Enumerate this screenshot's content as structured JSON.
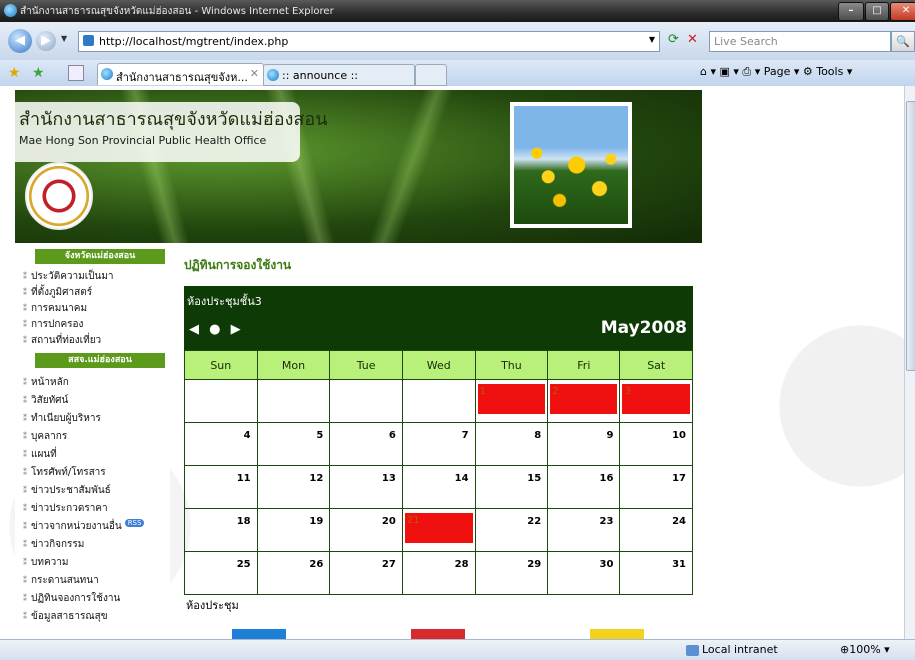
{
  "window": {
    "title": "สำนักงานสาธารณสุขจังหวัดแม่ฮ่องสอน - Windows Internet Explorer",
    "min": "–",
    "max": "□",
    "close": "✕"
  },
  "addressbar": {
    "url": "http://localhost/mgtrent/index.php",
    "search_placeholder": "Live Search",
    "back": "◀",
    "forward": "▶",
    "refresh": "⟳",
    "stop": "✕",
    "search_btn": "🔍"
  },
  "tabs": [
    {
      "label": "สำนักงานสาธารณสุขจังห...",
      "active": true,
      "close": "✕"
    },
    {
      "label": ":: announce ::",
      "active": false
    }
  ],
  "commandbar": "⌂ ▾  ▣ ▾  ⎙ ▾  Page ▾  ⚙ Tools ▾",
  "banner": {
    "title_th": "สำนักงานสาธารณสุขจังหวัดแม่ฮ่องสอน",
    "title_en": "Mae Hong Son Provincial Public Health Office"
  },
  "sidebar": {
    "section1": "จังหวัดแม่ฮ่องสอน",
    "items1": [
      "ประวัติความเป็นมา",
      "ที่ตั้งภูมิศาสตร์",
      "การคมนาคม",
      "การปกครอง",
      "สถานที่ท่องเที่ยว"
    ],
    "section2": "สสจ.แม่ฮ่องสอน",
    "items2": [
      "หน้าหลัก",
      "วิสัยทัศน์",
      "ทำเนียบผู้บริหาร",
      "บุคลากร",
      "แผนที่",
      "โทรศัพท์/โทรสาร",
      "ข่าวประชาสัมพันธ์",
      "ข่าวประกวดราคา",
      "ข่าวจากหน่วยงานอื่น",
      "ข่าวกิจกรรม",
      "บทความ",
      "กระดานสนทนา",
      "ปฏิทินจองการใช้งาน",
      "ข้อมูลสาธารณสุข"
    ],
    "rss_label": "RSS"
  },
  "main": {
    "heading": "ปฏิทินการจองใช้งาน",
    "room": "ห้องประชุมชั้น3",
    "nav": "◀ ● ▶",
    "month": "May2008",
    "weekdays": [
      "Sun",
      "Mon",
      "Tue",
      "Wed",
      "Thu",
      "Fri",
      "Sat"
    ],
    "weeks": [
      [
        "",
        "",
        "",
        "",
        "1",
        "2",
        "3"
      ],
      [
        "4",
        "5",
        "6",
        "7",
        "8",
        "9",
        "10"
      ],
      [
        "11",
        "12",
        "13",
        "14",
        "15",
        "16",
        "17"
      ],
      [
        "18",
        "19",
        "20",
        "21",
        "22",
        "23",
        "24"
      ],
      [
        "25",
        "26",
        "27",
        "28",
        "29",
        "30",
        "31"
      ]
    ],
    "booked_days": [
      "1",
      "2",
      "3",
      "21"
    ],
    "booking_color": "#f01010",
    "rooms_label": "ห้องประชุม"
  },
  "statusbar": {
    "zone": "Local intranet",
    "zoom": "100%"
  }
}
